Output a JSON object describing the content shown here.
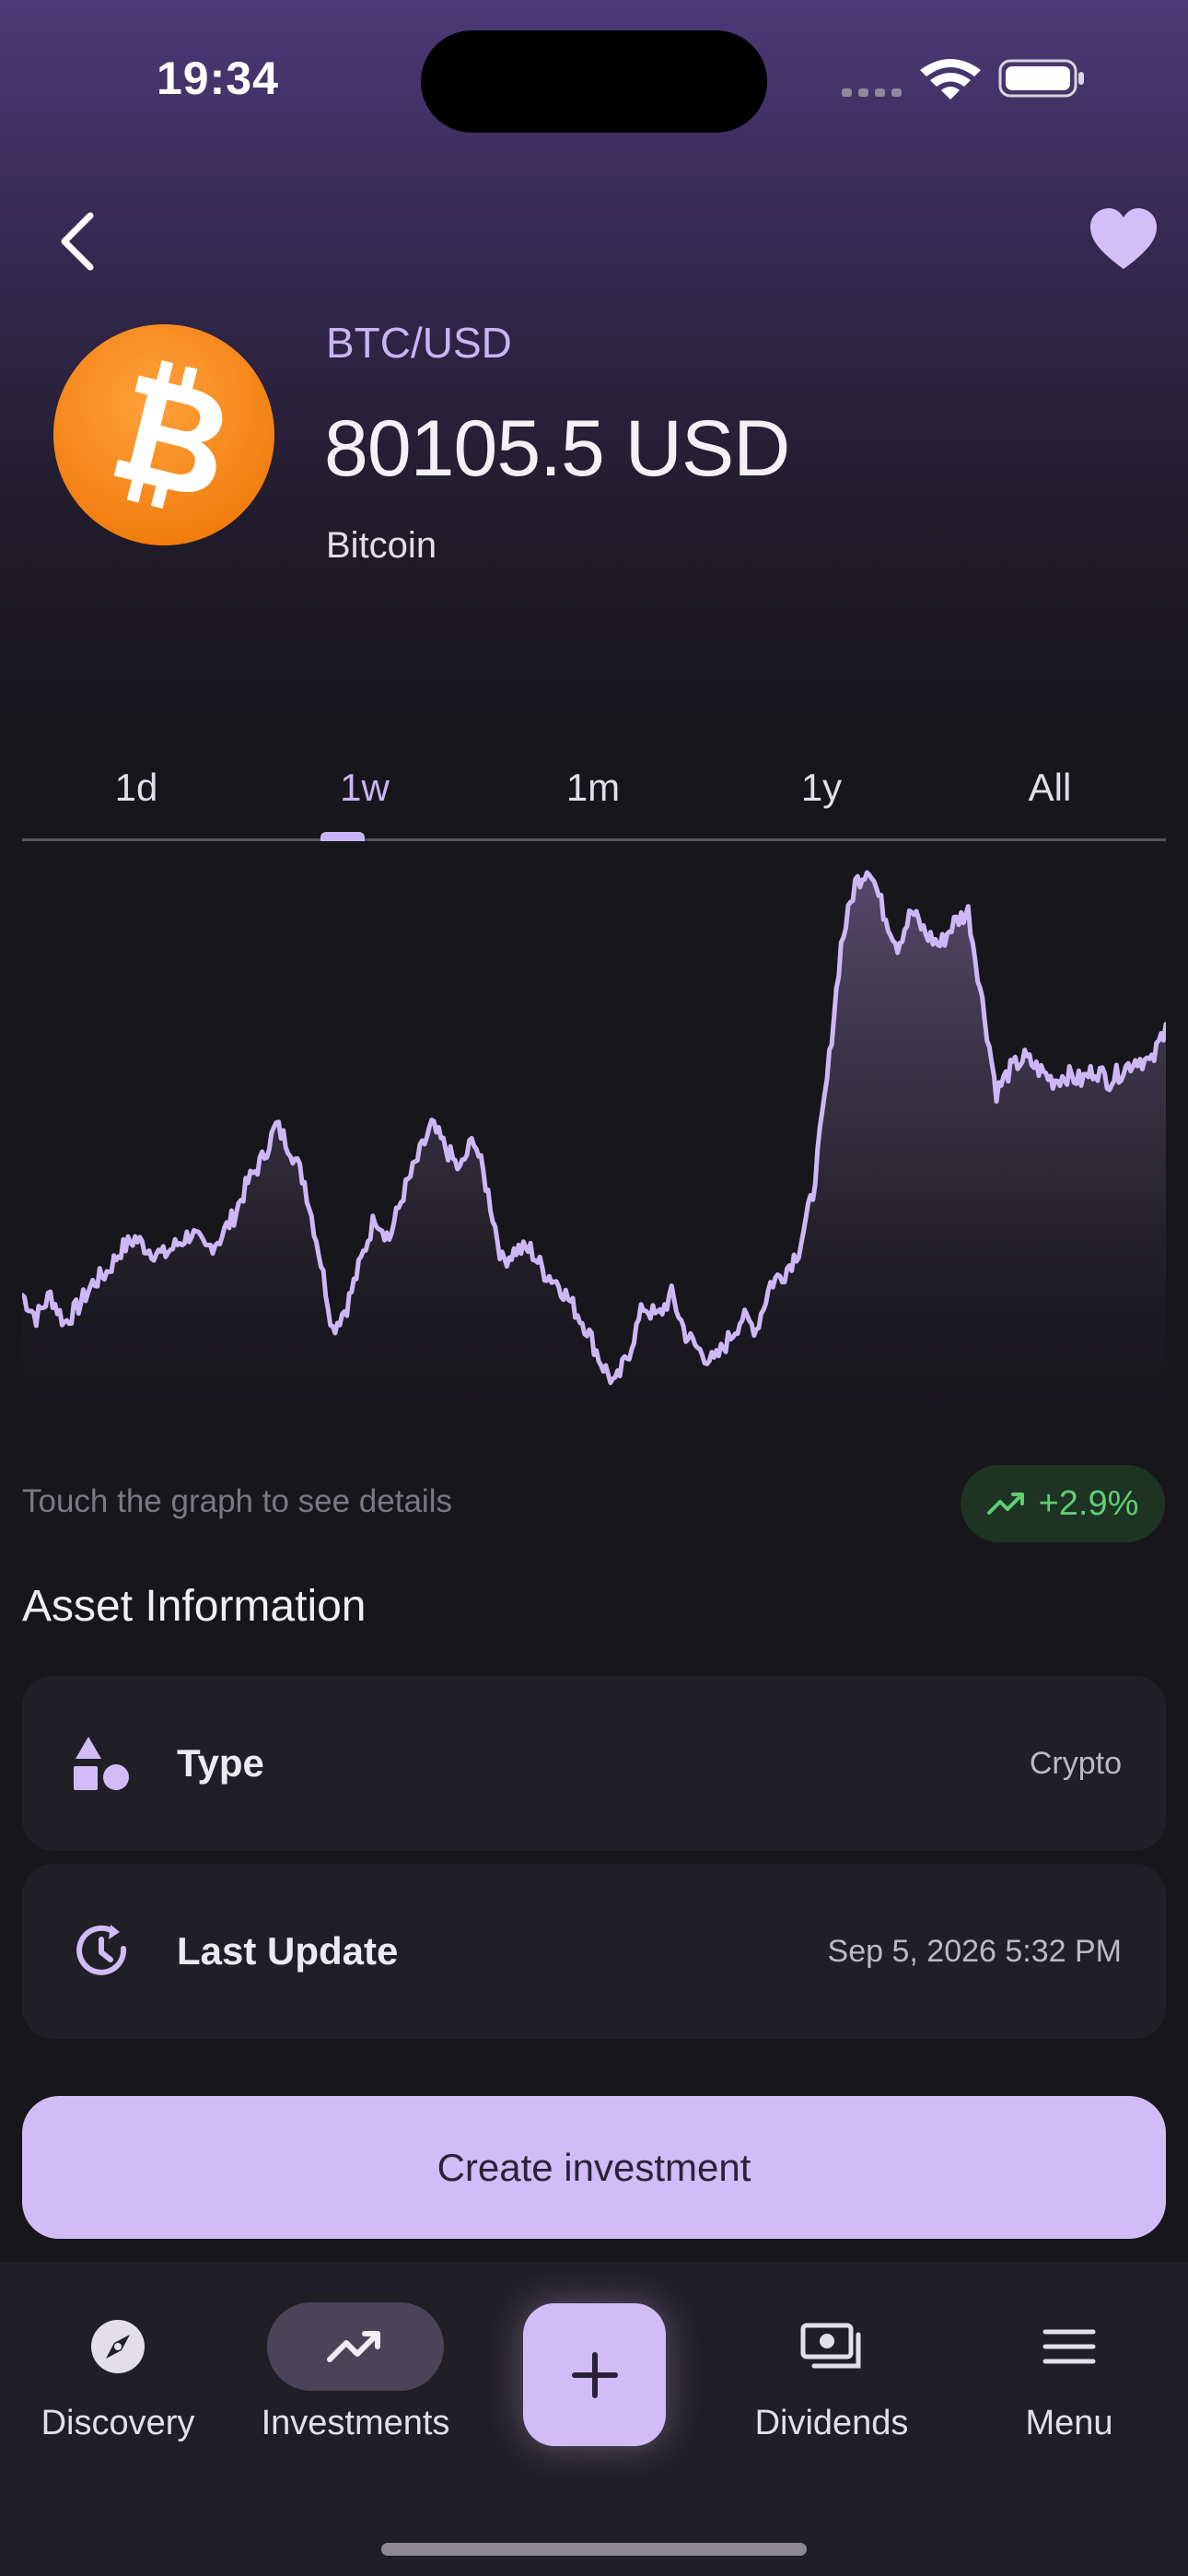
{
  "status_bar": {
    "time": "19:34"
  },
  "header": {
    "pair": "BTC/USD",
    "price": "80105.5 USD",
    "name": "Bitcoin",
    "logo_icon": "bitcoin-logo",
    "logo_color": "#f7931a"
  },
  "range_tabs": [
    {
      "label": "1d"
    },
    {
      "label": "1w",
      "active": true
    },
    {
      "label": "1m"
    },
    {
      "label": "1y"
    },
    {
      "label": "All"
    }
  ],
  "chart": {
    "hint": "Touch the graph to see details",
    "change": "+2.9%",
    "line_color": "#cdb8f7",
    "change_color": "#5fcf72"
  },
  "chart_data": {
    "type": "area",
    "y_relative": [
      0.22,
      0.18,
      0.22,
      0.17,
      0.2,
      0.24,
      0.26,
      0.3,
      0.32,
      0.3,
      0.29,
      0.31,
      0.33,
      0.3,
      0.32,
      0.36,
      0.42,
      0.46,
      0.52,
      0.48,
      0.42,
      0.3,
      0.16,
      0.2,
      0.28,
      0.36,
      0.32,
      0.4,
      0.46,
      0.52,
      0.48,
      0.44,
      0.5,
      0.4,
      0.28,
      0.3,
      0.3,
      0.26,
      0.24,
      0.2,
      0.16,
      0.1,
      0.06,
      0.12,
      0.2,
      0.18,
      0.22,
      0.15,
      0.12,
      0.1,
      0.14,
      0.18,
      0.16,
      0.24,
      0.26,
      0.3,
      0.4,
      0.6,
      0.84,
      0.95,
      0.98,
      0.9,
      0.84,
      0.9,
      0.86,
      0.84,
      0.88,
      0.9,
      0.74,
      0.58,
      0.62,
      0.64,
      0.62,
      0.6,
      0.61,
      0.6,
      0.62,
      0.6,
      0.62,
      0.64,
      0.63,
      0.7
    ],
    "fill": "gradient"
  },
  "asset_info": {
    "title": "Asset Information",
    "rows": [
      {
        "label": "Type",
        "value": "Crypto",
        "icon": "shapes-icon"
      },
      {
        "label": "Last Update",
        "value": "Sep 5, 2026 5:32 PM",
        "icon": "history-icon"
      }
    ]
  },
  "actions": {
    "create": "Create investment"
  },
  "nav": [
    {
      "label": "Discovery",
      "icon": "compass-icon"
    },
    {
      "label": "Investments",
      "icon": "trending-up-icon",
      "active": true
    },
    {
      "label": "",
      "icon": "plus-icon"
    },
    {
      "label": "Dividends",
      "icon": "payments-icon"
    },
    {
      "label": "Menu",
      "icon": "menu-icon"
    }
  ],
  "colors": {
    "accent": "#d0bcf7",
    "background": "#17161b",
    "card": "#211f26"
  }
}
